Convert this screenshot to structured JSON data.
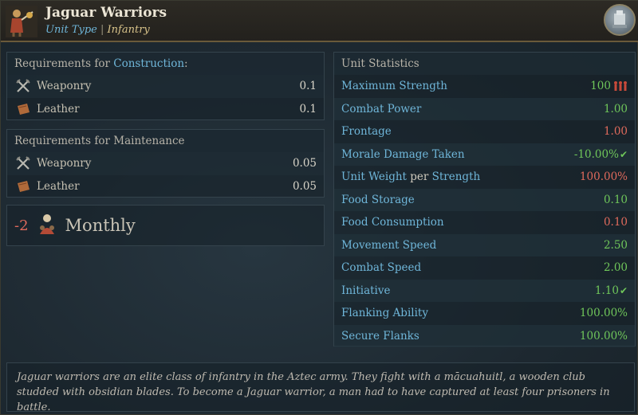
{
  "header": {
    "title": "Jaguar Warriors",
    "type_label": "Unit Type",
    "separator": "|",
    "type_value": "Infantry"
  },
  "construction": {
    "heading_prefix": "Requirements for ",
    "heading_highlight": "Construction",
    "heading_suffix": ":",
    "items": [
      {
        "icon": "weaponry-icon",
        "label": "Weaponry",
        "value": "0.1"
      },
      {
        "icon": "leather-icon",
        "label": "Leather",
        "value": "0.1"
      }
    ]
  },
  "maintenance": {
    "heading": "Requirements for Maintenance",
    "items": [
      {
        "icon": "weaponry-icon",
        "label": "Weaponry",
        "value": "0.05"
      },
      {
        "icon": "leather-icon",
        "label": "Leather",
        "value": "0.05"
      }
    ]
  },
  "monthly": {
    "value": "-2",
    "label": "Monthly"
  },
  "stats": {
    "heading": "Unit Statistics",
    "rows": [
      {
        "label": "Maximum Strength",
        "value": "100",
        "color": "green",
        "suffix_icon": "soldiers-icon"
      },
      {
        "label": "Combat Power",
        "value": "1.00",
        "color": "green"
      },
      {
        "label": "Frontage",
        "value": "1.00",
        "color": "red"
      },
      {
        "label": "Morale Damage Taken",
        "value": "-10.00%",
        "color": "green",
        "check": true
      },
      {
        "label": "Unit Weight",
        "label_mid": " per ",
        "label_end": "Strength",
        "value": "100.00%",
        "color": "red"
      },
      {
        "label": "Food Storage",
        "value": "0.10",
        "color": "green"
      },
      {
        "label": "Food Consumption",
        "value": "0.10",
        "color": "red"
      },
      {
        "label": "Movement Speed",
        "value": "2.50",
        "color": "green"
      },
      {
        "label": "Combat Speed",
        "value": "2.00",
        "color": "green"
      },
      {
        "label": "Initiative",
        "value": "1.10",
        "color": "green",
        "check": true
      },
      {
        "label": "Flanking Ability",
        "value": "100.00%",
        "color": "green"
      },
      {
        "label": "Secure Flanks",
        "value": "100.00%",
        "color": "green"
      }
    ]
  },
  "description": "Jaguar warriors are an elite class of infantry in the Aztec army. They fight with a mācuahuitl, a wooden club studded with obsidian blades. To become a Jaguar warrior, a man had to have captured at least four prisoners in battle.",
  "colors": {
    "accent_blue": "#6fb6d9",
    "positive": "#6fc65a",
    "negative": "#e06a5c",
    "gold": "#d8c38a"
  }
}
